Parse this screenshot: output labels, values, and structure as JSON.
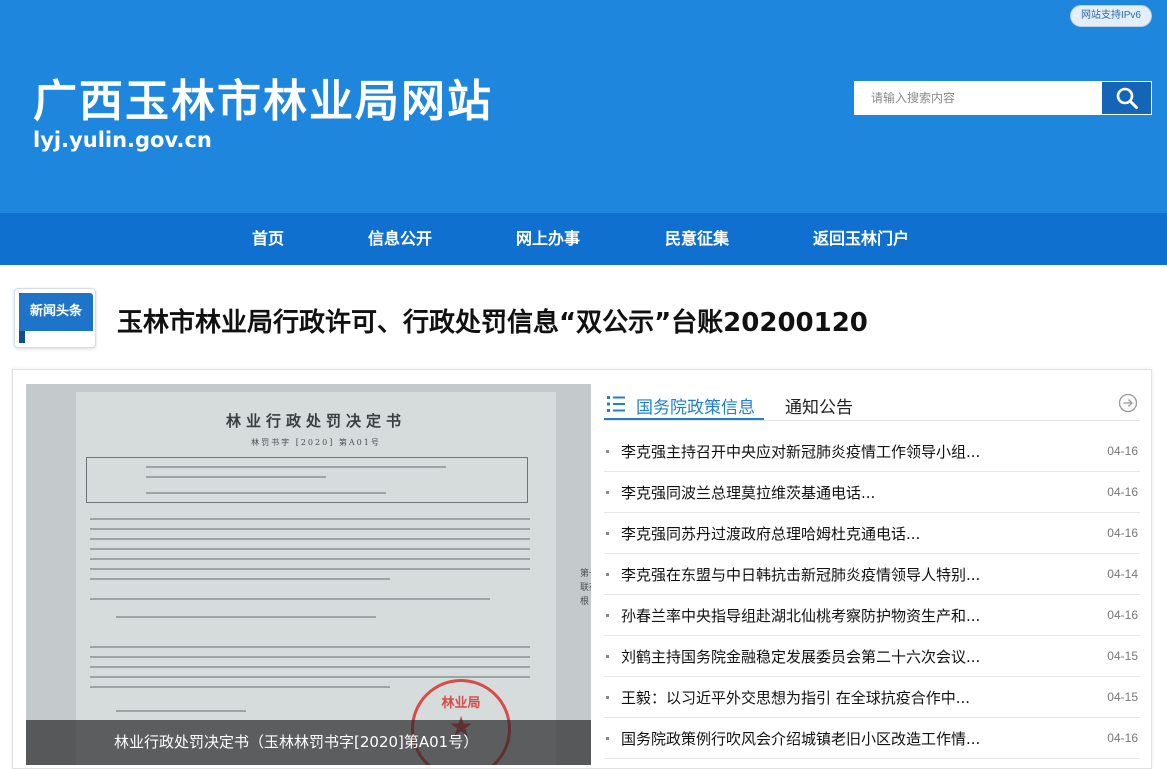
{
  "header": {
    "ipv6_badge": "网站支持IPv6",
    "site_title": "广西玉林市林业局网站",
    "site_domain": "lyj.yulin.gov.cn",
    "search_placeholder": "请输入搜索内容",
    "background_color": "#1e86dc"
  },
  "nav": {
    "items": [
      {
        "label": "首页"
      },
      {
        "label": "信息公开"
      },
      {
        "label": "网上办事"
      },
      {
        "label": "民意征集"
      },
      {
        "label": "返回玉林门户"
      }
    ],
    "background_color": "#0f70cf"
  },
  "headline": {
    "badge_label": "新闻头条",
    "title": "玉林市林业局行政许可、行政处罚信息“双公示”台账20200120"
  },
  "featured": {
    "doc_title": "林业行政处罚决定书",
    "doc_number": "林罚书字 [2020] 第A01号",
    "seal_text": "林业局",
    "side_text": "第一联存根",
    "caption": "林业行政处罚决定书（玉林林罚书字[2020]第A01号）"
  },
  "tabs": {
    "active": "国务院政策信息",
    "inactive": "通知公告",
    "accent_color": "#1e7fd6"
  },
  "news": [
    {
      "title": "李克强主持召开中央应对新冠肺炎疫情工作领导小组...",
      "date": "04-16"
    },
    {
      "title": "李克强同波兰总理莫拉维茨基通电话...",
      "date": "04-16"
    },
    {
      "title": "李克强同苏丹过渡政府总理哈姆杜克通电话...",
      "date": "04-16"
    },
    {
      "title": "李克强在东盟与中日韩抗击新冠肺炎疫情领导人特别...",
      "date": "04-14"
    },
    {
      "title": "孙春兰率中央指导组赴湖北仙桃考察防护物资生产和...",
      "date": "04-16"
    },
    {
      "title": "刘鹤主持国务院金融稳定发展委员会第二十六次会议...",
      "date": "04-15"
    },
    {
      "title": "王毅：以习近平外交思想为指引 在全球抗疫合作中...",
      "date": "04-15"
    },
    {
      "title": "国务院政策例行吹风会介绍城镇老旧小区改造工作情...",
      "date": "04-16"
    }
  ]
}
